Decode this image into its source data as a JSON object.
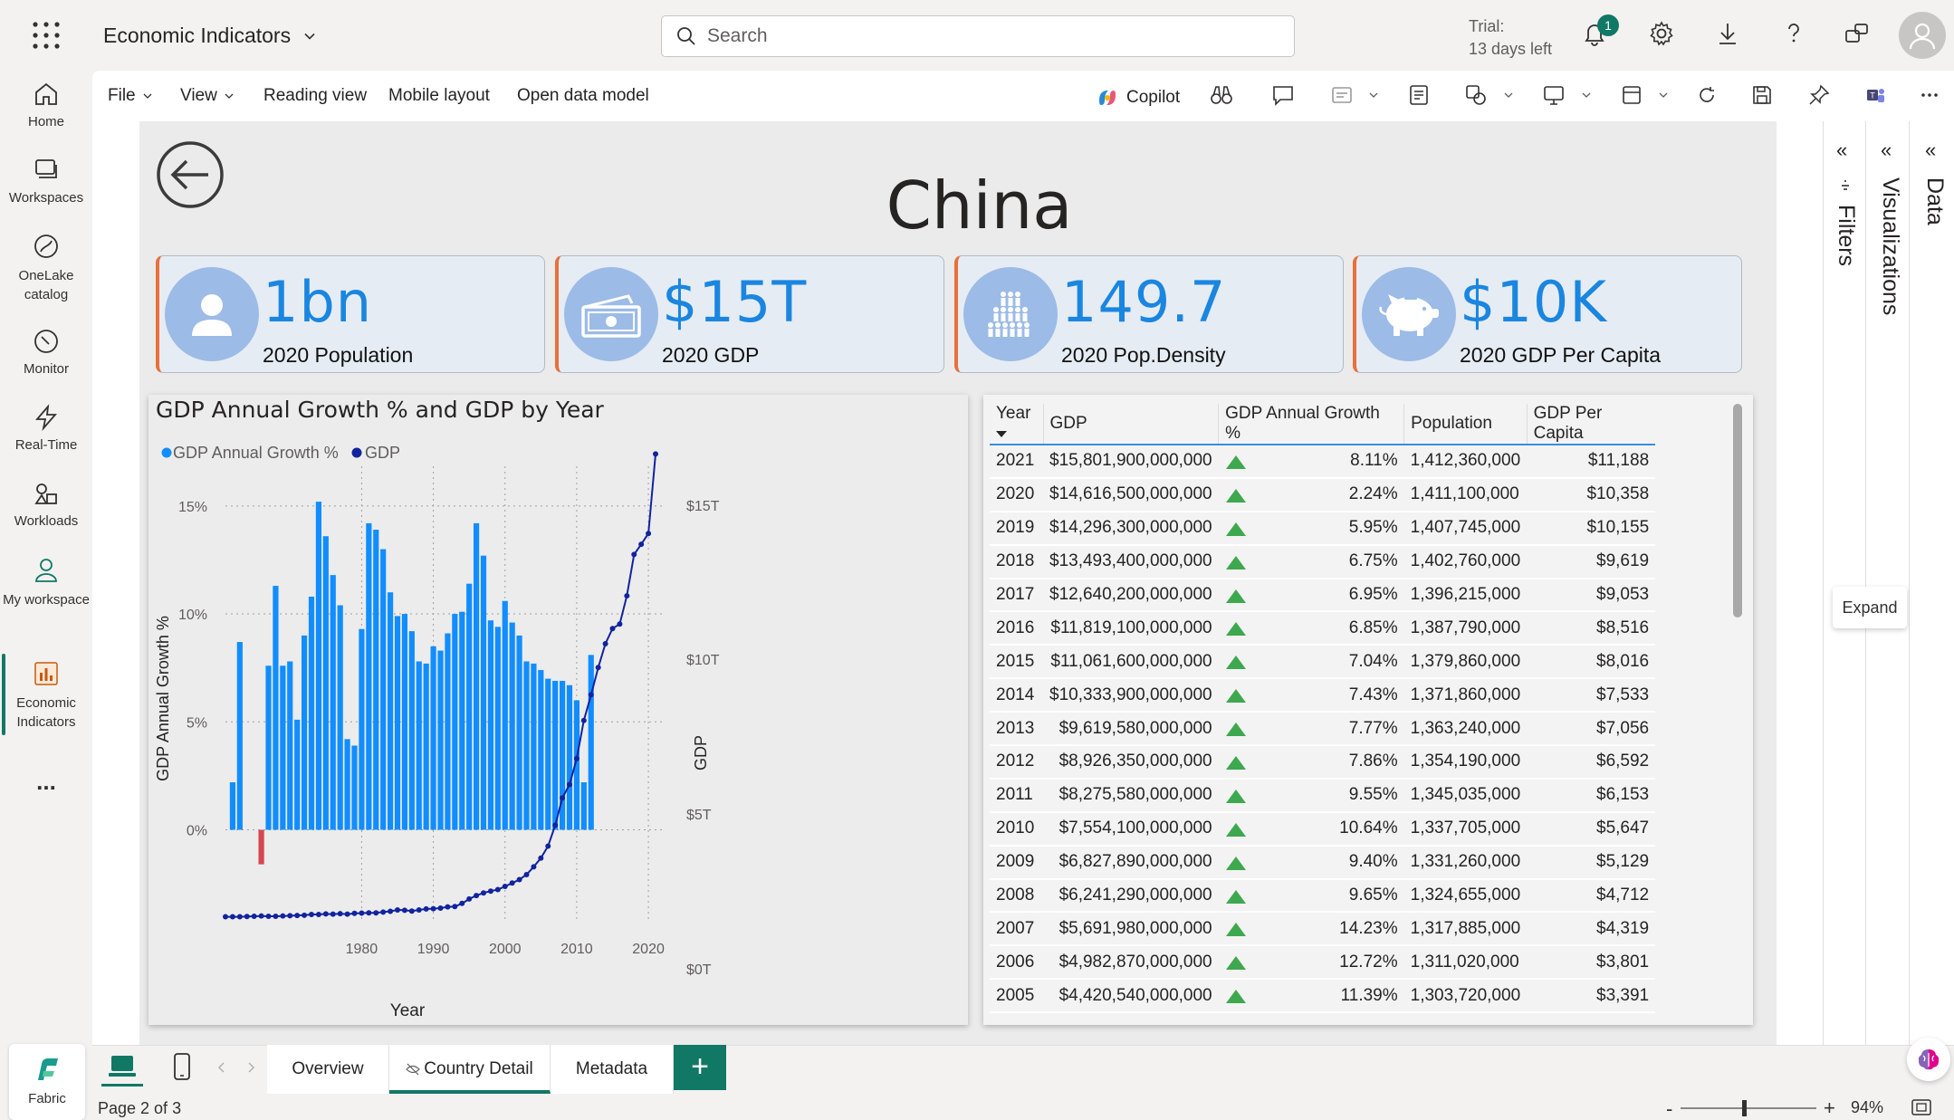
{
  "app": {
    "title": "Economic Indicators",
    "search_placeholder": "Search",
    "trial_line1": "Trial:",
    "trial_line2": "13 days left",
    "notification_count": "1"
  },
  "nav": {
    "items": [
      {
        "label": "Home"
      },
      {
        "label": "Workspaces"
      },
      {
        "label": "OneLake catalog"
      },
      {
        "label": "Monitor"
      },
      {
        "label": "Real-Time"
      },
      {
        "label": "Workloads"
      },
      {
        "label": "My workspace"
      },
      {
        "label": "Economic Indicators"
      }
    ],
    "more": "...",
    "fabric_label": "Fabric"
  },
  "menu": {
    "file": "File",
    "view": "View",
    "reading_view": "Reading view",
    "mobile_layout": "Mobile layout",
    "open_data_model": "Open data model",
    "copilot": "Copilot"
  },
  "report": {
    "country": "China",
    "kpis": [
      {
        "value": "1bn",
        "label": "2020 Population",
        "icon": "person-icon"
      },
      {
        "value": "$15T",
        "label": "2020 GDP",
        "icon": "money-icon"
      },
      {
        "value": "149.7",
        "label": "2020 Pop.Density",
        "icon": "crowd-icon"
      },
      {
        "value": "$10K",
        "label": "2020 GDP Per Capita",
        "icon": "piggy-bank-icon"
      }
    ]
  },
  "chart_data": {
    "type": "bar+line",
    "title": "GDP Annual Growth % and GDP by Year",
    "legend": [
      "GDP Annual Growth %",
      "GDP"
    ],
    "legend_placement": "top-left",
    "xlabel": "Year",
    "ylabel_left": "GDP Annual Growth %",
    "ylabel_right": "GDP",
    "left_ticks": [
      "15%",
      "10%",
      "5%",
      "0%"
    ],
    "right_ticks": [
      "$15T",
      "$10T",
      "$5T",
      "$0T"
    ],
    "x_ticks": [
      "1980",
      "1990",
      "2000",
      "2010",
      "2020"
    ],
    "colors": {
      "bar": "#118dff",
      "bar_negative": "#d64550",
      "line": "#12239e"
    },
    "x": [
      1961,
      1962,
      1963,
      1964,
      1965,
      1966,
      1967,
      1968,
      1969,
      1970,
      1971,
      1972,
      1973,
      1974,
      1975,
      1976,
      1977,
      1978,
      1979,
      1980,
      1981,
      1982,
      1983,
      1984,
      1985,
      1986,
      1987,
      1988,
      1989,
      1990,
      1991,
      1992,
      1993,
      1994,
      1995,
      1996,
      1997,
      1998,
      1999,
      2000,
      2001,
      2002,
      2003,
      2004,
      2005,
      2006,
      2007,
      2008,
      2009,
      2010,
      2011,
      2012,
      2013,
      2014,
      2015,
      2016,
      2017,
      2018,
      2019,
      2020,
      2021
    ],
    "growth_pct": [
      null,
      null,
      null,
      null,
      null,
      null,
      null,
      null,
      null,
      null,
      null,
      null,
      null,
      null,
      null,
      null,
      null,
      null,
      null,
      null,
      null,
      null,
      null,
      null,
      null,
      null,
      null,
      null,
      null,
      null,
      null,
      null,
      null,
      null,
      null,
      null,
      null,
      null,
      null,
      null,
      null,
      null,
      null,
      null,
      null,
      null,
      null,
      null,
      null,
      null,
      null,
      null,
      null,
      null,
      null,
      null,
      null,
      null,
      null,
      null,
      null
    ],
    "growth_series": [
      {
        "year": 1961,
        "value": null
      },
      {
        "year": 1962,
        "value": 2.2
      },
      {
        "year": 1963,
        "value": 8.7
      },
      {
        "year": 1964,
        "value": null
      },
      {
        "year": 1965,
        "value": null
      },
      {
        "year": 1966,
        "value": -1.6
      },
      {
        "year": 1967,
        "value": 7.6
      },
      {
        "year": 1968,
        "value": 11.3
      },
      {
        "year": 1969,
        "value": 7.6
      },
      {
        "year": 1970,
        "value": 7.8
      },
      {
        "year": 1971,
        "value": 5.1
      },
      {
        "year": 1972,
        "value": 9.0
      },
      {
        "year": 1973,
        "value": 10.8
      },
      {
        "year": 1974,
        "value": 15.2
      },
      {
        "year": 1975,
        "value": 13.6
      },
      {
        "year": 1976,
        "value": 11.8
      },
      {
        "year": 1977,
        "value": 10.4
      },
      {
        "year": 1978,
        "value": 4.2
      },
      {
        "year": 1979,
        "value": 3.9
      },
      {
        "year": 1980,
        "value": 9.3
      },
      {
        "year": 1981,
        "value": 14.2
      },
      {
        "year": 1982,
        "value": 13.9
      },
      {
        "year": 1983,
        "value": 13.0
      },
      {
        "year": 1984,
        "value": 11.0
      },
      {
        "year": 1985,
        "value": 9.9
      },
      {
        "year": 1986,
        "value": 10.0
      },
      {
        "year": 1987,
        "value": 9.2
      },
      {
        "year": 1988,
        "value": 7.8
      },
      {
        "year": 1989,
        "value": 7.7
      },
      {
        "year": 1990,
        "value": 8.5
      },
      {
        "year": 1991,
        "value": 8.3
      },
      {
        "year": 1992,
        "value": 9.1
      },
      {
        "year": 1993,
        "value": 10.0
      },
      {
        "year": 1994,
        "value": 10.1
      },
      {
        "year": 1995,
        "value": 11.4
      },
      {
        "year": 1996,
        "value": 14.2
      },
      {
        "year": 1997,
        "value": 12.7
      },
      {
        "year": 1998,
        "value": 9.7
      },
      {
        "year": 1999,
        "value": 9.4
      },
      {
        "year": 2000,
        "value": 10.6
      },
      {
        "year": 2001,
        "value": 9.6
      },
      {
        "year": 2002,
        "value": 9.0
      },
      {
        "year": 2003,
        "value": 7.8
      },
      {
        "year": 2004,
        "value": 7.7
      },
      {
        "year": 2005,
        "value": 7.4
      },
      {
        "year": 2006,
        "value": 7.0
      },
      {
        "year": 2007,
        "value": 6.9
      },
      {
        "year": 2008,
        "value": 6.9
      },
      {
        "year": 2009,
        "value": 6.7
      },
      {
        "year": 2010,
        "value": 6.0
      },
      {
        "year": 2011,
        "value": 2.2
      },
      {
        "year": 2012,
        "value": 8.1
      }
    ],
    "gdp_trillions": [
      0.05,
      0.05,
      0.05,
      0.06,
      0.07,
      0.08,
      0.07,
      0.07,
      0.08,
      0.09,
      0.1,
      0.11,
      0.14,
      0.14,
      0.16,
      0.15,
      0.17,
      0.15,
      0.18,
      0.19,
      0.2,
      0.2,
      0.23,
      0.26,
      0.31,
      0.3,
      0.27,
      0.31,
      0.35,
      0.36,
      0.38,
      0.43,
      0.44,
      0.56,
      0.73,
      0.86,
      0.96,
      1.03,
      1.09,
      1.21,
      1.34,
      1.47,
      1.66,
      1.96,
      2.29,
      2.75,
      3.55,
      4.59,
      5.1,
      6.09,
      7.55,
      8.53,
      9.57,
      10.48,
      11.06,
      11.23,
      12.31,
      13.89,
      14.28,
      14.69,
      17.73
    ]
  },
  "table": {
    "columns": [
      "Year",
      "GDP",
      "GDP Annual Growth %",
      "Population",
      "GDP Per Capita"
    ],
    "rows": [
      [
        "2021",
        "$15,801,900,000,000",
        "8.11%",
        "1,412,360,000",
        "$11,188"
      ],
      [
        "2020",
        "$14,616,500,000,000",
        "2.24%",
        "1,411,100,000",
        "$10,358"
      ],
      [
        "2019",
        "$14,296,300,000,000",
        "5.95%",
        "1,407,745,000",
        "$10,155"
      ],
      [
        "2018",
        "$13,493,400,000,000",
        "6.75%",
        "1,402,760,000",
        "$9,619"
      ],
      [
        "2017",
        "$12,640,200,000,000",
        "6.95%",
        "1,396,215,000",
        "$9,053"
      ],
      [
        "2016",
        "$11,819,100,000,000",
        "6.85%",
        "1,387,790,000",
        "$8,516"
      ],
      [
        "2015",
        "$11,061,600,000,000",
        "7.04%",
        "1,379,860,000",
        "$8,016"
      ],
      [
        "2014",
        "$10,333,900,000,000",
        "7.43%",
        "1,371,860,000",
        "$7,533"
      ],
      [
        "2013",
        "$9,619,580,000,000",
        "7.77%",
        "1,363,240,000",
        "$7,056"
      ],
      [
        "2012",
        "$8,926,350,000,000",
        "7.86%",
        "1,354,190,000",
        "$6,592"
      ],
      [
        "2011",
        "$8,275,580,000,000",
        "9.55%",
        "1,345,035,000",
        "$6,153"
      ],
      [
        "2010",
        "$7,554,100,000,000",
        "10.64%",
        "1,337,705,000",
        "$5,647"
      ],
      [
        "2009",
        "$6,827,890,000,000",
        "9.40%",
        "1,331,260,000",
        "$5,129"
      ],
      [
        "2008",
        "$6,241,290,000,000",
        "9.65%",
        "1,324,655,000",
        "$4,712"
      ],
      [
        "2007",
        "$5,691,980,000,000",
        "14.23%",
        "1,317,885,000",
        "$4,319"
      ],
      [
        "2006",
        "$4,982,870,000,000",
        "12.72%",
        "1,311,020,000",
        "$3,801"
      ],
      [
        "2005",
        "$4,420,540,000,000",
        "11.39%",
        "1,303,720,000",
        "$3,391"
      ]
    ]
  },
  "panes": {
    "filters": "Filters",
    "visualizations": "Visualizations",
    "data": "Data",
    "expand_tooltip": "Expand"
  },
  "pages": {
    "tabs": [
      "Overview",
      "Country Detail",
      "Metadata"
    ],
    "active": "Country Detail",
    "add_label": "+",
    "indicator": "Page 2 of 3",
    "zoom": "94%"
  }
}
